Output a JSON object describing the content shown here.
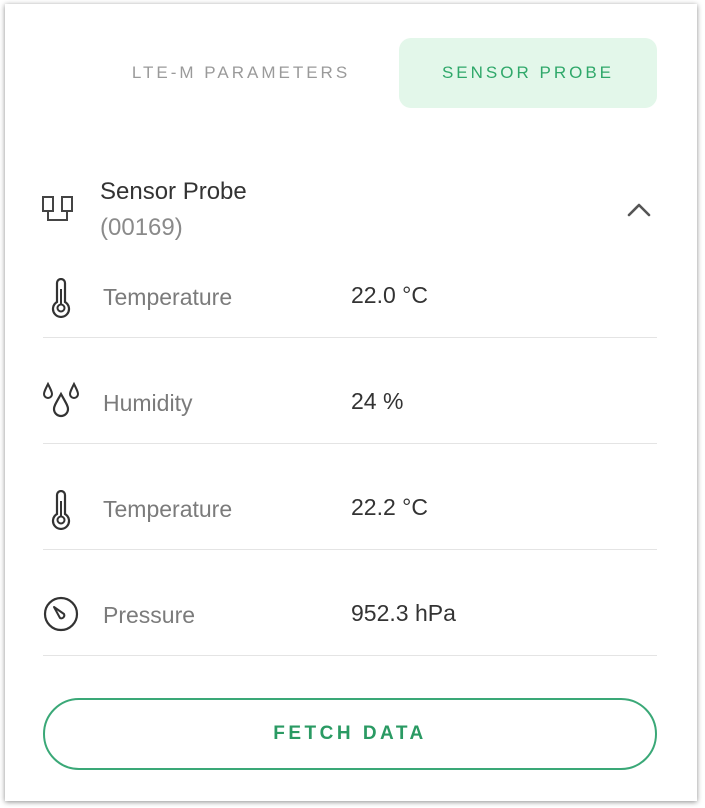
{
  "tabs": [
    {
      "label": "LTE-M PARAMETERS",
      "active": false
    },
    {
      "label": "SENSOR PROBE",
      "active": true
    }
  ],
  "device": {
    "title": "Sensor Probe",
    "subtitle": "(00169)",
    "icon": "device-icon",
    "collapse_icon": "chevron-up-icon"
  },
  "readings": [
    {
      "icon": "thermometer-icon",
      "label": "Temperature",
      "value": "22.0 °C"
    },
    {
      "icon": "humidity-icon",
      "label": "Humidity",
      "value": "24 %"
    },
    {
      "icon": "thermometer-icon",
      "label": "Temperature",
      "value": "22.2 °C"
    },
    {
      "icon": "gauge-icon",
      "label": "Pressure",
      "value": "952.3 hPa"
    }
  ],
  "fetch_button": {
    "label": "FETCH DATA"
  },
  "colors": {
    "accent": "#2fa86a",
    "active_tab_bg": "#e3f7ea",
    "inactive_tab_text": "#9a9a9a",
    "divider": "#e4e4e4"
  }
}
